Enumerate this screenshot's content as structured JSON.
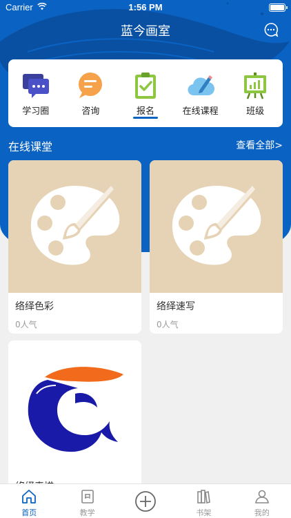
{
  "status": {
    "carrier": "Carrier",
    "time": "1:56 PM"
  },
  "nav": {
    "title": "蓝今画室"
  },
  "quick_menu": [
    {
      "label": "学习圈",
      "icon": "chat-bubbles-icon"
    },
    {
      "label": "咨询",
      "icon": "consult-icon"
    },
    {
      "label": "报名",
      "icon": "clipboard-check-icon",
      "selected": true
    },
    {
      "label": "在线课程",
      "icon": "cloud-pencil-icon"
    },
    {
      "label": "班级",
      "icon": "easel-chart-icon"
    }
  ],
  "section": {
    "title": "在线课堂",
    "see_all": "查看全部>"
  },
  "courses": [
    {
      "name": "络绎色彩",
      "popularity": "0人气",
      "icon": "palette-icon"
    },
    {
      "name": "络绎速写",
      "popularity": "0人气",
      "icon": "palette-icon"
    },
    {
      "name": "络绎素描",
      "icon": "logo-image"
    }
  ],
  "tabbar": [
    {
      "label": "首页",
      "icon": "home-icon",
      "active": true
    },
    {
      "label": "教学",
      "icon": "book-icon"
    },
    {
      "label": "",
      "icon": "plus-circle-icon"
    },
    {
      "label": "书架",
      "icon": "bookshelf-icon"
    },
    {
      "label": "我的",
      "icon": "user-icon"
    }
  ],
  "colors": {
    "brand": "#0a63c3",
    "thumb_bg": "#e6d3b5"
  }
}
